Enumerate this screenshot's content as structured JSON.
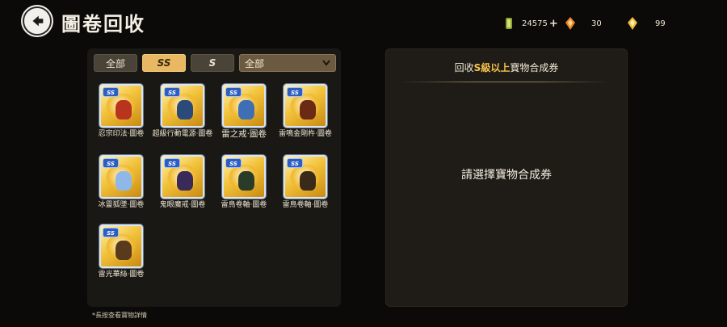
{
  "header": {
    "title": "圖卷回收",
    "currencies": [
      {
        "icon": "green-coin-icon",
        "value": "24575",
        "has_plus": true
      },
      {
        "icon": "orange-crystal-icon",
        "value": "30",
        "has_plus": false
      },
      {
        "icon": "gold-crystal-icon",
        "value": "99",
        "has_plus": false
      }
    ]
  },
  "filters": {
    "tabs": [
      {
        "label": "全部",
        "active": false
      },
      {
        "label": "SS",
        "active": true
      },
      {
        "label": "S",
        "active": false
      }
    ],
    "select_value": "全部"
  },
  "items": [
    {
      "name": "忍宗印法·圖卷",
      "grade": "SS",
      "fig": "#b8341f"
    },
    {
      "name": "超級行動電源·圖卷",
      "grade": "SS",
      "fig": "#2a4a7a"
    },
    {
      "name": "雷之戒·圖卷",
      "grade": "SS",
      "fig": "#3e6fb4"
    },
    {
      "name": "雷鳴金剛杵·圖卷",
      "grade": "SS",
      "fig": "#6a2a14"
    },
    {
      "name": "冰靈狐墜·圖卷",
      "grade": "SS",
      "fig": "#8fb7e8"
    },
    {
      "name": "鬼眼魔戒·圖卷",
      "grade": "SS",
      "fig": "#3a2a5a"
    },
    {
      "name": "雷鳥卷軸·圖卷",
      "grade": "SS",
      "fig": "#2b3b2a"
    },
    {
      "name": "雷鳥卷軸·圖卷",
      "grade": "SS",
      "fig": "#3a2a1a"
    },
    {
      "name": "雷光華絲·圖卷",
      "grade": "SS",
      "fig": "#5a3a1c"
    }
  ],
  "hint": "*長按查看寶物詳情",
  "right_panel": {
    "title_prefix": "回收",
    "title_highlight": "S級以上",
    "title_suffix": "寶物合成券",
    "message": "請選擇寶物合成券"
  }
}
